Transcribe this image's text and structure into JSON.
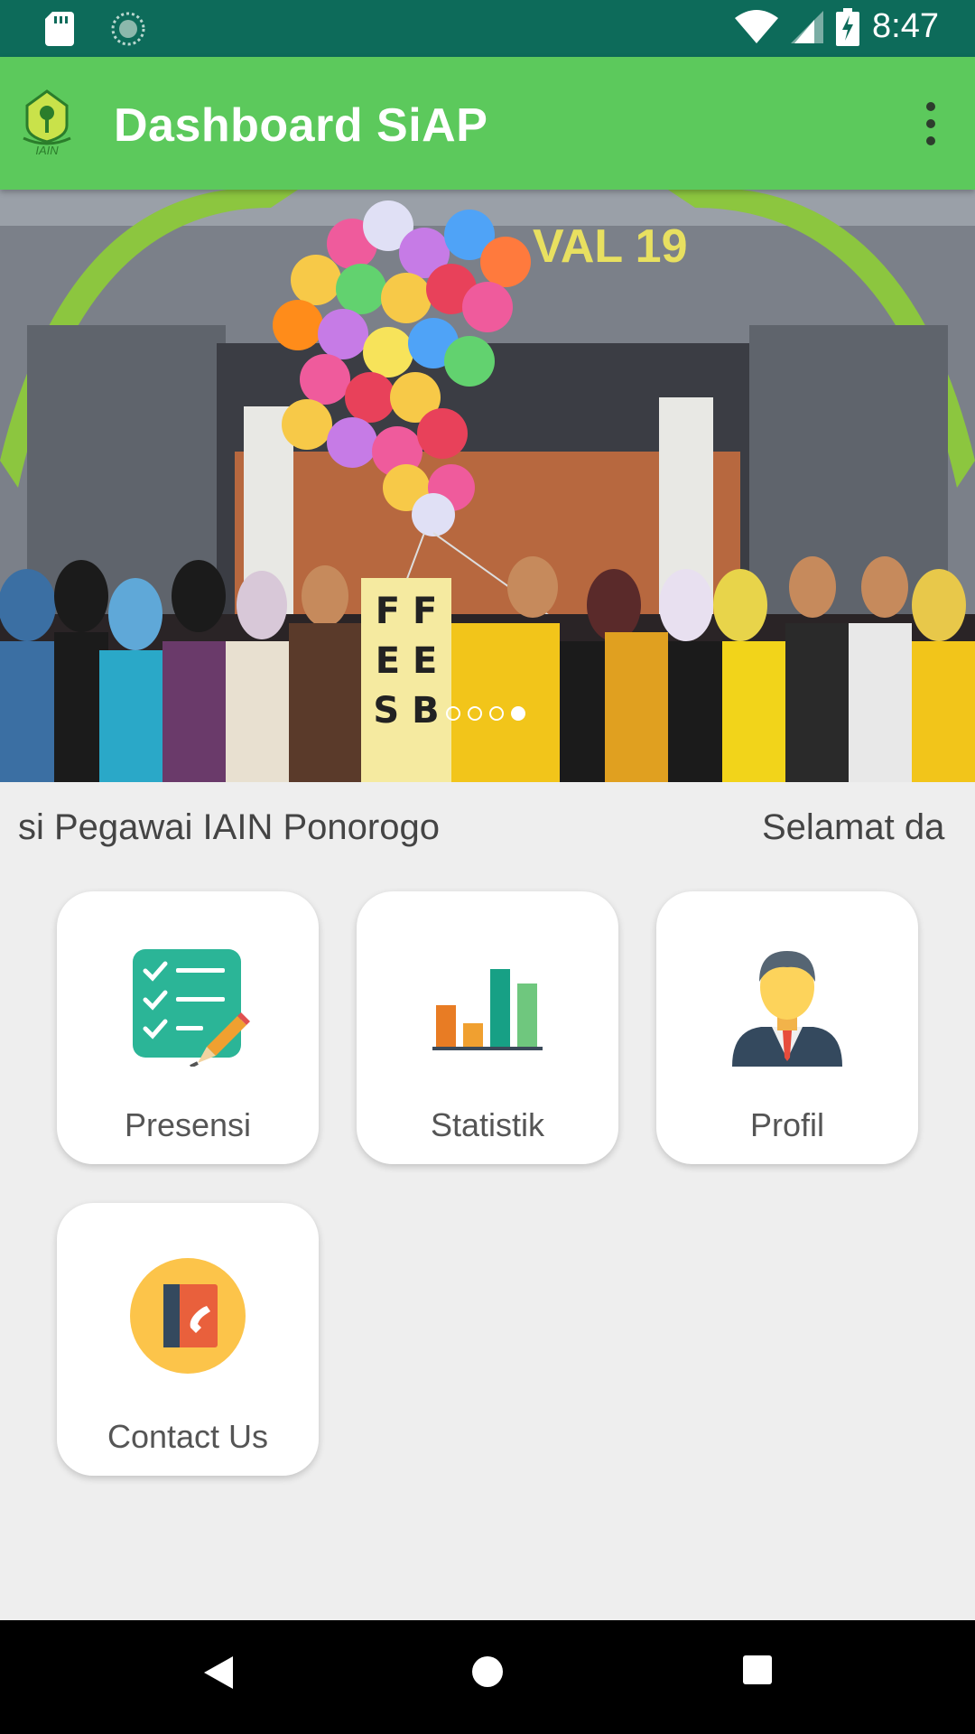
{
  "status_bar": {
    "time": "8:47",
    "icons": [
      "sd-card-icon",
      "sync-icon",
      "wifi-icon",
      "cell-signal-icon",
      "battery-charging-icon"
    ]
  },
  "app_bar": {
    "title": "Dashboard SiAP",
    "logo_text": "IAIN",
    "menu_icon": "more-vert-icon"
  },
  "banner": {
    "sign_text": "VAL 19",
    "placard_letters": [
      "F",
      "F",
      "E",
      "E",
      "S",
      "B"
    ],
    "page_count": 4,
    "active_page": 4
  },
  "marquee": {
    "text_left": "si Pegawai IAIN Ponorogo",
    "text_right": "Selamat da"
  },
  "menu": {
    "items": [
      {
        "label": "Presensi",
        "icon": "checklist-icon"
      },
      {
        "label": "Statistik",
        "icon": "bar-chart-icon"
      },
      {
        "label": "Profil",
        "icon": "user-profile-icon"
      },
      {
        "label": "Contact Us",
        "icon": "contact-book-icon"
      }
    ]
  },
  "nav_bar": {
    "buttons": [
      "back-icon",
      "home-icon",
      "recents-icon"
    ]
  },
  "colors": {
    "status_bar": "#0d6b5a",
    "app_bar": "#5cc95c",
    "background": "#eeeeee"
  }
}
